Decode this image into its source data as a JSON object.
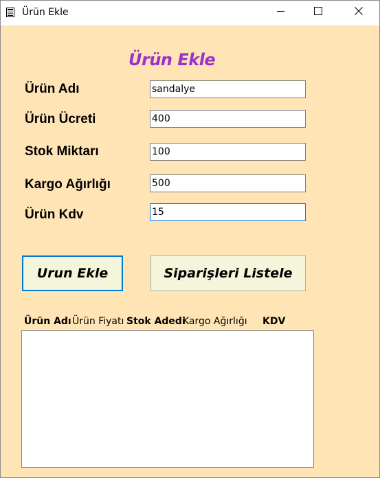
{
  "window": {
    "title": "Ürün Ekle",
    "icon": "form-icon"
  },
  "titlebar_buttons": {
    "minimize_icon": "minimize-icon",
    "maximize_icon": "maximize-icon",
    "close_icon": "close-icon"
  },
  "form": {
    "heading": "Ürün Ekle",
    "fields": [
      {
        "label": "Ürün Adı",
        "value": "sandalye"
      },
      {
        "label": "Ürün Ücreti",
        "value": "400"
      },
      {
        "label": "Stok Miktarı",
        "value": "100"
      },
      {
        "label": "Kargo Ağırlığı",
        "value": "500"
      },
      {
        "label": "Ürün Kdv",
        "value": "15"
      }
    ]
  },
  "buttons": {
    "add_label": "Urun Ekle",
    "list_label": "Siparişleri Listele"
  },
  "list": {
    "columns": [
      "Ürün Adı",
      "Ürün Fiyatı",
      "Stok Adedi",
      "Kargo Ağırlığı",
      "KDV"
    ],
    "rows": []
  },
  "colors": {
    "form_background": "#ffe4b5",
    "heading": "#9932cc",
    "button_background": "#f5f5dc",
    "focus_accent": "#0078d7"
  }
}
